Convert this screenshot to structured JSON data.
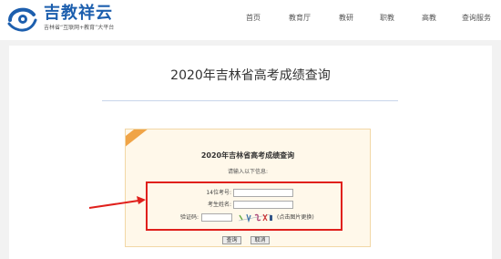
{
  "brand": {
    "name": "吉教祥云",
    "tagline": "吉林省“互联网+教育”大平台",
    "logo_icon": "jijiao-xiangyun-logo",
    "color": "#1d5fae"
  },
  "nav": {
    "items": [
      {
        "label": "首页"
      },
      {
        "label": "教育厅"
      },
      {
        "label": "教研"
      },
      {
        "label": "职教"
      },
      {
        "label": "高教"
      },
      {
        "label": "查询服务"
      }
    ]
  },
  "page": {
    "title": "2020年吉林省高考成绩查询"
  },
  "form": {
    "title": "2020年吉林省高考成绩查询",
    "hint": "请输入以下信息:",
    "exam_number_label": "14位考号:",
    "exam_number_value": "",
    "name_label": "考生姓名:",
    "name_value": "",
    "captcha_label": "验证码:",
    "captcha_value": "",
    "captcha_refresh_text": "(点击图片更换)",
    "submit_label": "查询",
    "cancel_label": "取消",
    "accent_color": "#f0a447"
  },
  "annotation": {
    "color": "#e0201c"
  }
}
